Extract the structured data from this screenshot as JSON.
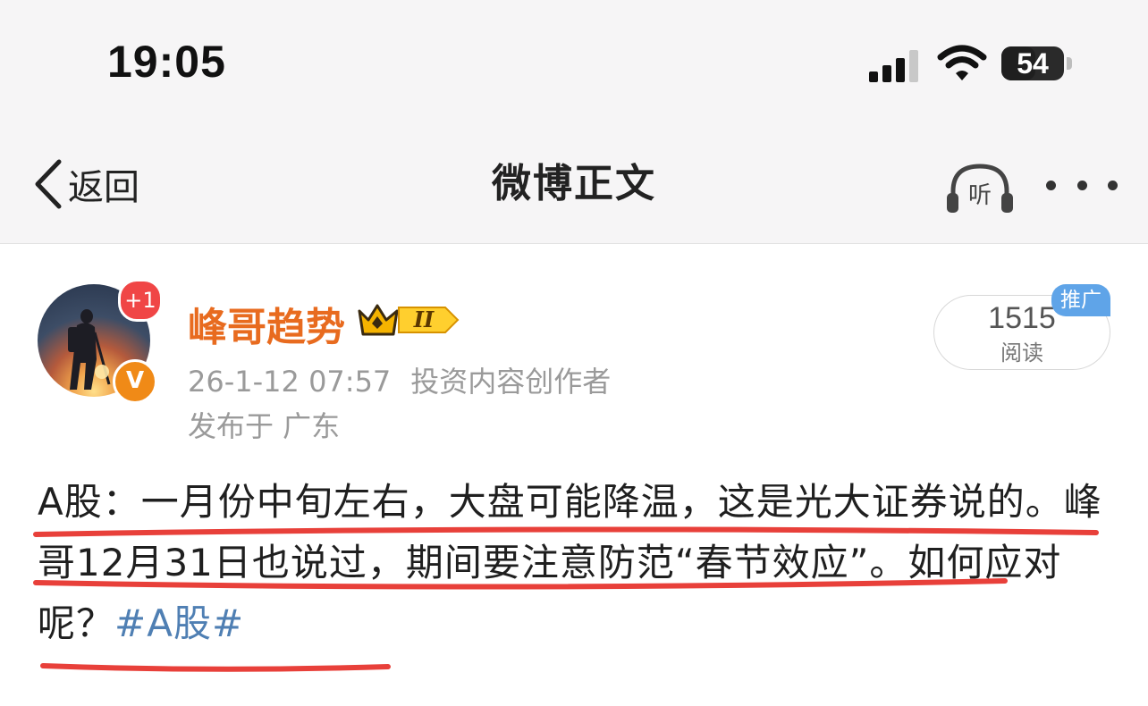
{
  "status_bar": {
    "time": "19:05",
    "battery_level": 54,
    "battery_text": "54"
  },
  "nav": {
    "back_label": "返回",
    "title": "微博正文",
    "listen_label": "听"
  },
  "post": {
    "author": {
      "name": "峰哥趋势",
      "unread_badge": "+1",
      "verified_mark": "V",
      "member_level": "II"
    },
    "timestamp": "26-1-12 07:57",
    "author_role": "投资内容创作者",
    "location": "发布于 广东",
    "read_count": "1515",
    "read_label": "阅读",
    "promo_tag": "推广",
    "text": "A股：一月份中旬左右，大盘可能降温，这是光大证券说的。峰哥12月31日也说过，期间要注意防范“春节效应”。如何应对呢？",
    "topic": "#A股#"
  },
  "colors": {
    "brand_orange": "#e86b1f",
    "topic_blue": "#4f7fb3",
    "underline_red": "#e8403a",
    "promo_blue": "#5fa4e8"
  }
}
